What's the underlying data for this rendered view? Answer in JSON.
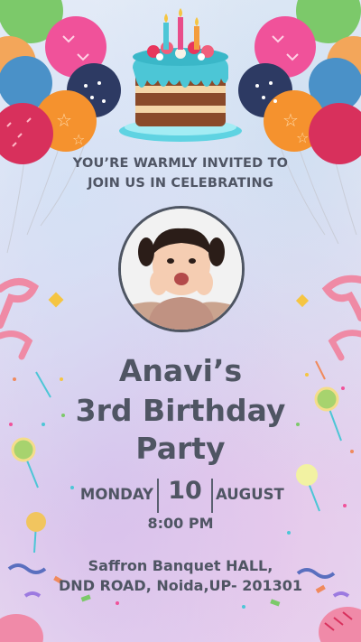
{
  "invitation": {
    "intro_line1": "YOU’RE WARMLY INVITED TO",
    "intro_line2": "JOIN US IN CELEBRATING",
    "name_line": "Anavi’s",
    "title_line2": "3rd Birthday",
    "title_line3": "Party",
    "day": "MONDAY",
    "date": "10",
    "month": "AUGUST",
    "time": "8:00 PM",
    "venue_line1": "Saffron Banquet HALL,",
    "venue_line2": "DND ROAD, Noida,UP- 201301"
  },
  "colors": {
    "text": "#4f5563",
    "balloon_pink": "#e84d8a",
    "balloon_orange": "#f39c3d",
    "balloon_navy": "#3c4a74",
    "balloon_green": "#6cc26a",
    "cake_icing": "#4cc6d6",
    "ribbon": "#ef8aa5"
  },
  "icons": [
    "balloons-left-cluster",
    "balloons-right-cluster",
    "birthday-cake-icon",
    "child-photo",
    "ribbon-decoration",
    "lollipop-decoration",
    "confetti"
  ]
}
